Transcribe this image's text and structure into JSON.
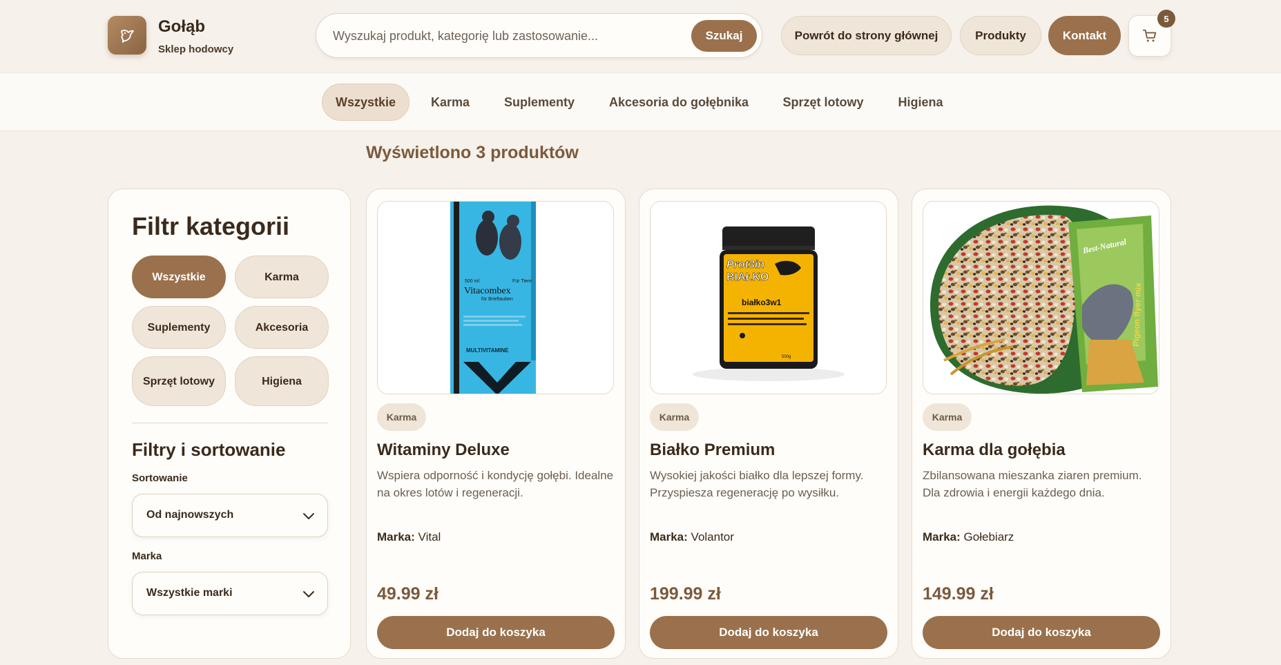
{
  "brand": {
    "name": "Gołąb",
    "subtitle": "Sklep hodowcy",
    "logo_icon": "pigeon-icon"
  },
  "search": {
    "placeholder": "Wyszukaj produkt, kategorię lub zastosowanie...",
    "value": "",
    "button_label": "Szukaj"
  },
  "nav": {
    "home": "Powrót do strony głównej",
    "products": "Produkty",
    "contact": "Kontakt"
  },
  "cart": {
    "icon": "cart-icon",
    "count": "5"
  },
  "category_tabs": [
    "Wszystkie",
    "Karma",
    "Suplementy",
    "Akcesoria do gołębnika",
    "Sprzęt lotowy",
    "Higiena"
  ],
  "active_tab": "Wszystkie",
  "results_count": "Wyświetlono 3 produktów",
  "sidebar": {
    "title": "Filtr kategorii",
    "chips": [
      "Wszystkie",
      "Karma",
      "Suplementy",
      "Akcesoria",
      "Sprzęt lotowy",
      "Higiena"
    ],
    "filters_title": "Filtry i sortowanie",
    "sort_label": "Sortowanie",
    "sort_value": "Od najnowszych",
    "brand_label": "Marka",
    "brand_value": "Wszystkie marki"
  },
  "products": [
    {
      "category": "Karma",
      "name": "Witaminy Deluxe",
      "description": "Wspiera odporność i kondycję gołębi. Idealne na okres lotów i regeneracji.",
      "brand_label": "Marka:",
      "brand": "Vital",
      "price": "49.99 zł",
      "button": "Dodaj do koszyka",
      "image_text": {
        "volume": "500 ml",
        "name": "Vitacombex",
        "sub": "für Brieftauben",
        "label": "MULTIVITAMINE",
        "tiere": "Für Tiere"
      }
    },
    {
      "category": "Karma",
      "name": "Białko Premium",
      "description": "Wysokiej jakości białko dla lepszej formy. Przyspiesza regenerację po wysiłku.",
      "brand_label": "Marka:",
      "brand": "Volantor",
      "price": "199.99 zł",
      "button": "Dodaj do koszyka",
      "image_text": {
        "line1": "Prot3in",
        "line2": "BIAŁKO",
        "sub": "białko3w1",
        "weight": "500g"
      }
    },
    {
      "category": "Karma",
      "name": "Karma dla gołębia",
      "description": "Zbilansowana mieszanka ziaren premium. Dla zdrowia i energii każdego dnia.",
      "brand_label": "Marka:",
      "brand": "Gołebiarz",
      "price": "149.99 zł",
      "button": "Dodaj do koszyka",
      "image_text": {
        "brand": "Best-Natural",
        "product": "Pigeon flyer mix"
      }
    }
  ]
}
